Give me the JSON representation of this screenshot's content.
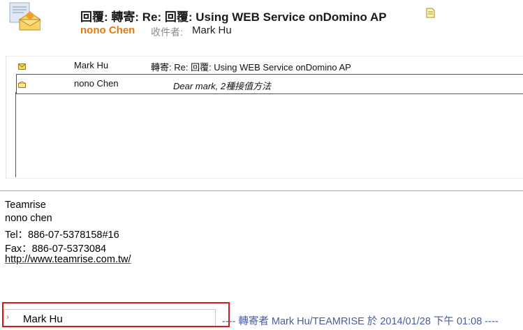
{
  "header": {
    "subject": "回覆: 轉寄: Re: 回覆: Using WEB Service onDomino AP",
    "from_name": "nono Chen",
    "to_label": "收件者:",
    "to_name": "Mark Hu"
  },
  "thread": {
    "rows": [
      {
        "from": "Mark Hu",
        "subject": "轉寄: Re: 回覆: Using WEB Service onDomino AP"
      },
      {
        "from": "nono Chen",
        "snippet": "Dear mark, 2種接值方法"
      }
    ]
  },
  "body": {
    "signature": [
      "Teamrise",
      "nono chen",
      "Tel：886-07-5378158#16",
      "Fax：886-07-5373084"
    ],
    "link": "http://www.teamrise.com.tw/"
  },
  "footer": {
    "reply_chevron": "›",
    "reply_name": "Mark Hu",
    "forward_info": "---- 轉寄者 Mark Hu/TEAMRISE 於 2014/01/28 下午 01:08 ----"
  },
  "colors": {
    "from_name": "#e07a10",
    "forward_info": "#4a5aa0",
    "highlight_box": "#d01c1c"
  }
}
